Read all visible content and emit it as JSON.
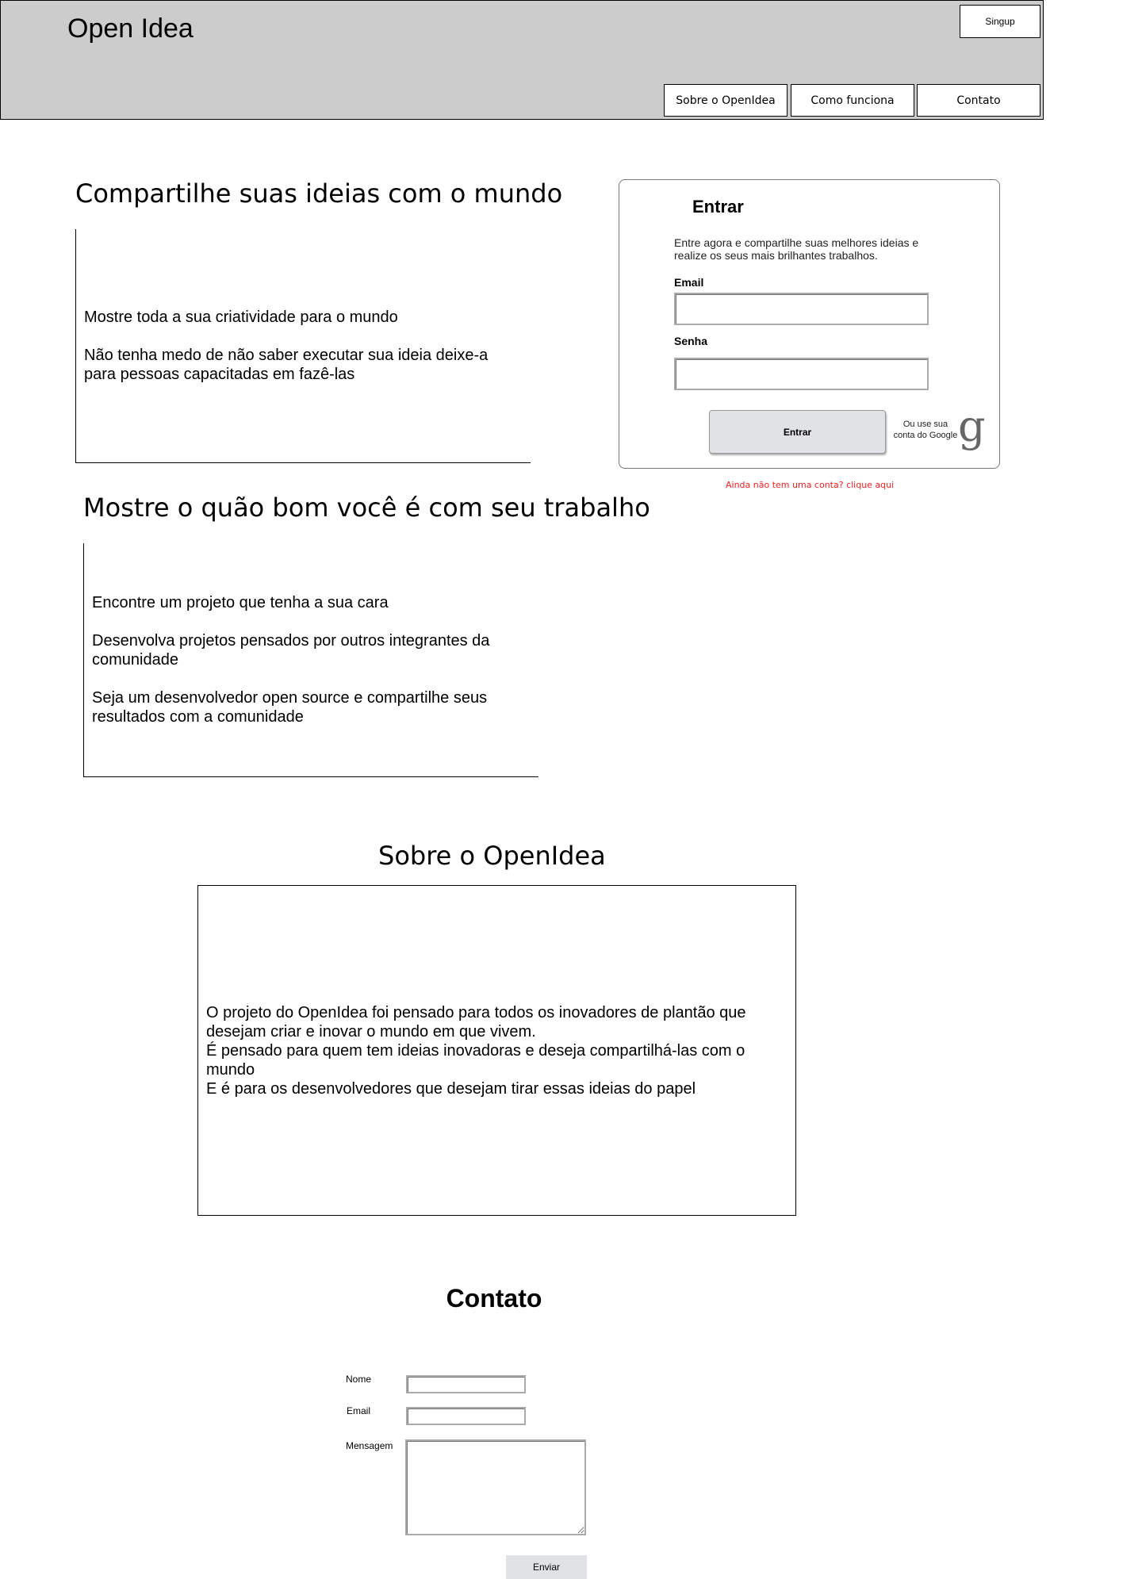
{
  "header": {
    "logo": "Open Idea",
    "signup_label": "Singup",
    "nav": {
      "sobre": "Sobre o OpenIdea",
      "como": "Como funciona",
      "contato": "Contato"
    }
  },
  "hero1": {
    "title": "Compartilhe suas ideias com o mundo",
    "paragraphs": [
      "Mostre toda a sua criatividade para o mundo",
      "Não tenha medo de não saber executar sua ideia deixe-a para pessoas capacitadas em fazê-las"
    ]
  },
  "hero2": {
    "title": "Mostre o quão bom você é com seu trabalho",
    "paragraphs": [
      "Encontre um projeto que tenha a sua cara",
      "Desenvolva projetos pensados por outros integrantes da comunidade",
      "Seja um desenvolvedor open source e compartilhe seus resultados com a comunidade"
    ]
  },
  "login": {
    "title": "Entrar",
    "description": "Entre agora e compartilhe suas melhores ideias e realize os seus mais brilhantes trabalhos.",
    "email_label": "Email",
    "senha_label": "Senha",
    "email_value": "",
    "senha_value": "",
    "button_label": "Entrar",
    "google_text": "Ou use sua conta do Google",
    "google_icon_glyph": "g",
    "google_icon": "google-icon",
    "signup_link": "Ainda não tem uma conta? clique aqui",
    "signup_link_color": "#ee2222"
  },
  "about": {
    "title": "Sobre o OpenIdea",
    "lines": [
      "O projeto do OpenIdea foi pensado para todos os inovadores de plantão que desejam criar e inovar o mundo em que vivem.",
      "É pensado para quem tem ideias inovadoras e deseja compartilhá-las com o mundo",
      "E é para os desenvolvedores que desejam tirar essas ideias do papel"
    ]
  },
  "contact": {
    "title": "Contato",
    "nome_label": "Nome",
    "email_label": "Email",
    "mensagem_label": "Mensagem",
    "nome_value": "",
    "email_value": "",
    "mensagem_value": "",
    "submit_label": "Enviar"
  },
  "colors": {
    "header_bg": "#cccccc",
    "button_bg": "#e1e2e6"
  }
}
